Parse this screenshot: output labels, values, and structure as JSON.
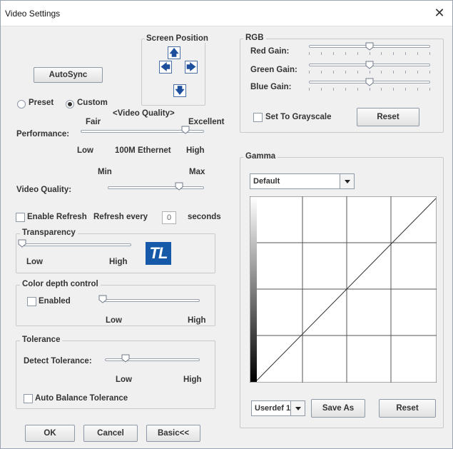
{
  "window": {
    "title": "Video Settings"
  },
  "screen_position": {
    "title": "Screen Position"
  },
  "autosync": {
    "label": "AutoSync"
  },
  "mode": {
    "preset": "Preset",
    "custom": "Custom",
    "selected": "Custom"
  },
  "performance": {
    "caption": "<Video Quality>",
    "label": "Performance:",
    "fair": "Fair",
    "excellent": "Excellent",
    "low": "Low",
    "mid": "100M Ethernet",
    "high": "High",
    "value": 0.85
  },
  "video_quality": {
    "label": "Video Quality:",
    "min": "Min",
    "max": "Max",
    "value": 0.74
  },
  "refresh": {
    "enable": "Enable Refresh",
    "every": "Refresh every",
    "value": "0",
    "unit": "seconds"
  },
  "transparency": {
    "title": "Transparency",
    "low": "Low",
    "high": "High",
    "value": 0.0,
    "logo": "TL"
  },
  "color_depth": {
    "title": "Color depth control",
    "enabled": "Enabled",
    "low": "Low",
    "high": "High",
    "value": 0.0
  },
  "tolerance": {
    "title": "Tolerance",
    "detect": "Detect Tolerance:",
    "low": "Low",
    "high": "High",
    "auto": "Auto Balance Tolerance",
    "value": 0.22
  },
  "buttons": {
    "ok": "OK",
    "cancel": "Cancel",
    "basic": "Basic<<"
  },
  "rgb": {
    "title": "RGB",
    "red": "Red Gain:",
    "red_value": 0.5,
    "green": "Green Gain:",
    "green_value": 0.5,
    "blue": "Blue Gain:",
    "blue_value": 0.5,
    "grayscale": "Set To Grayscale",
    "reset": "Reset"
  },
  "gamma": {
    "title": "Gamma",
    "preset": "Default",
    "user": "Userdef 1",
    "save_as": "Save As",
    "reset": "Reset"
  }
}
